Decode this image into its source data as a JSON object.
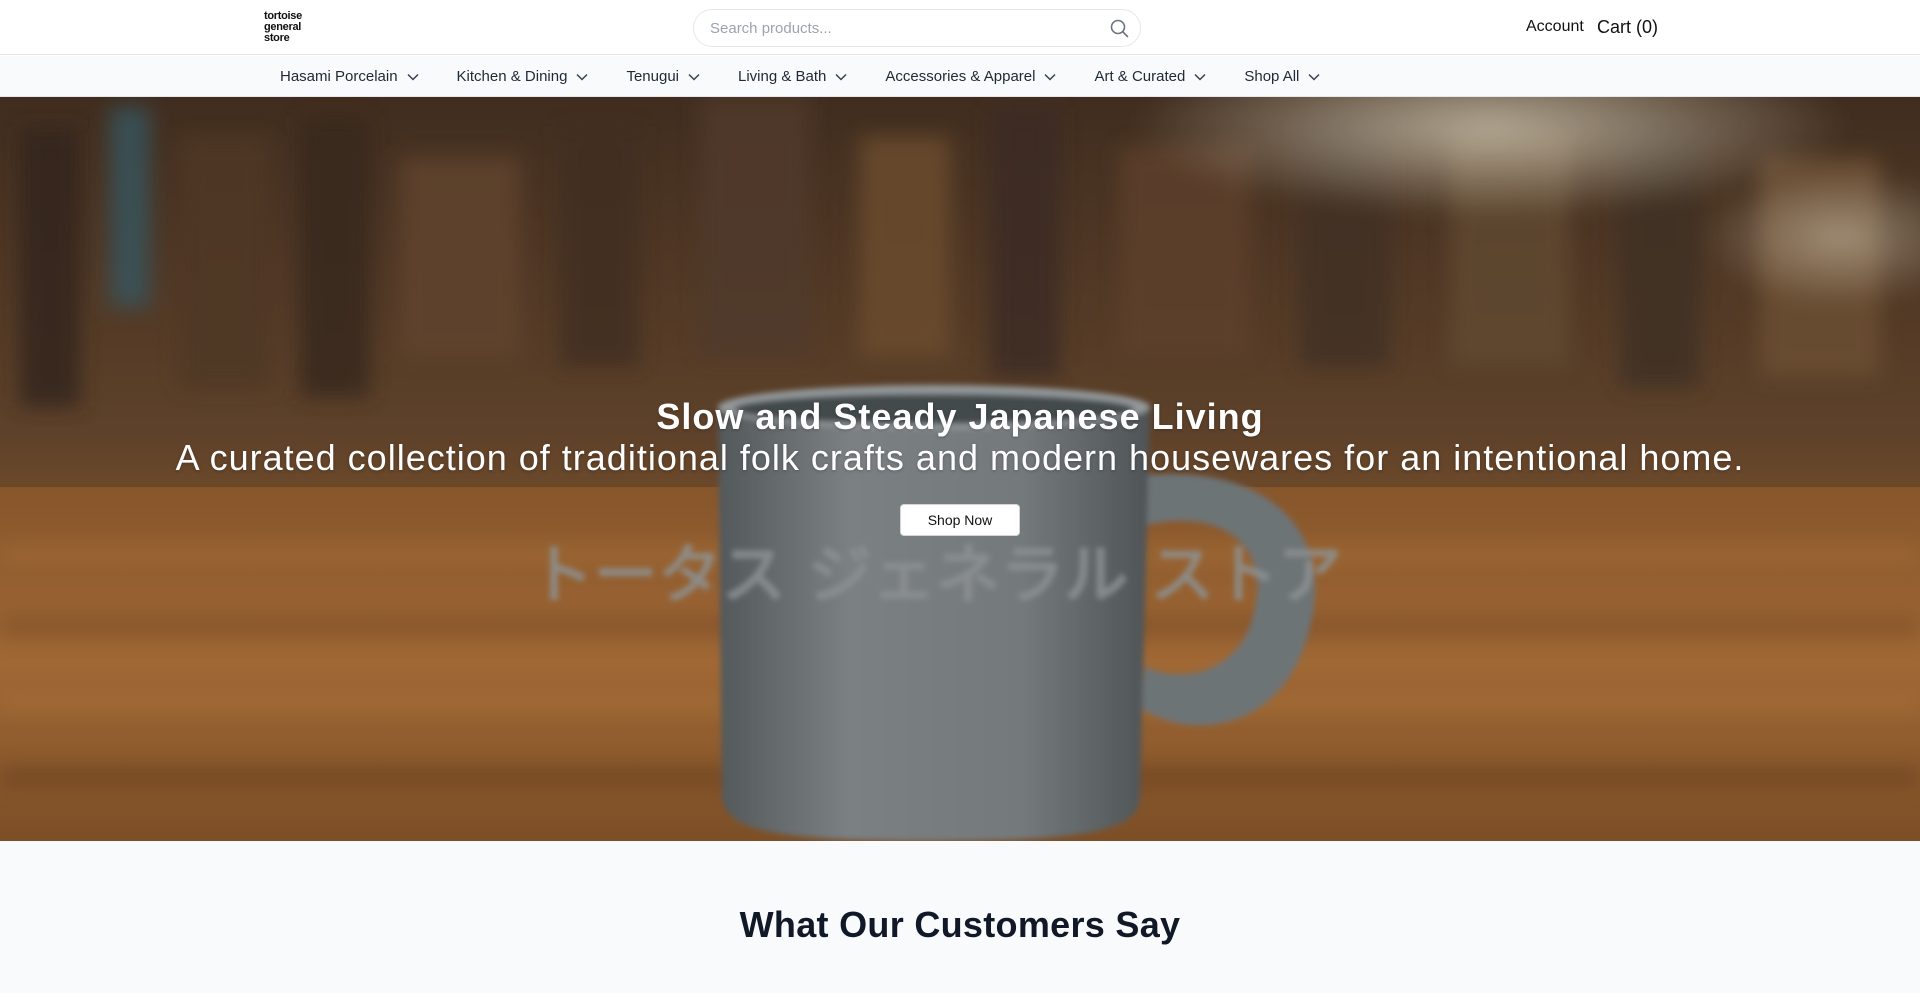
{
  "header": {
    "logo_lines": [
      "tortoise",
      "general",
      "store"
    ],
    "search_placeholder": "Search products...",
    "account_label": "Account",
    "cart_label": "Cart (0)"
  },
  "nav": {
    "items": [
      {
        "label": "Hasami Porcelain"
      },
      {
        "label": "Kitchen & Dining"
      },
      {
        "label": "Tenugui"
      },
      {
        "label": "Living & Bath"
      },
      {
        "label": "Accessories & Apparel"
      },
      {
        "label": "Art & Curated"
      },
      {
        "label": "Shop All"
      }
    ]
  },
  "hero": {
    "title": "Slow and Steady Japanese Living",
    "subtitle": "A curated collection of traditional folk crafts and modern housewares for an intentional home.",
    "cta_label": "Shop Now",
    "mug_text": "トータス ジェネラル ストア"
  },
  "testimonials": {
    "heading": "What Our Customers Say"
  },
  "colors": {
    "text": "#111827",
    "nav_bg": "#f9fafb",
    "section_bg": "#f8fafc",
    "border": "#e5e7eb"
  }
}
